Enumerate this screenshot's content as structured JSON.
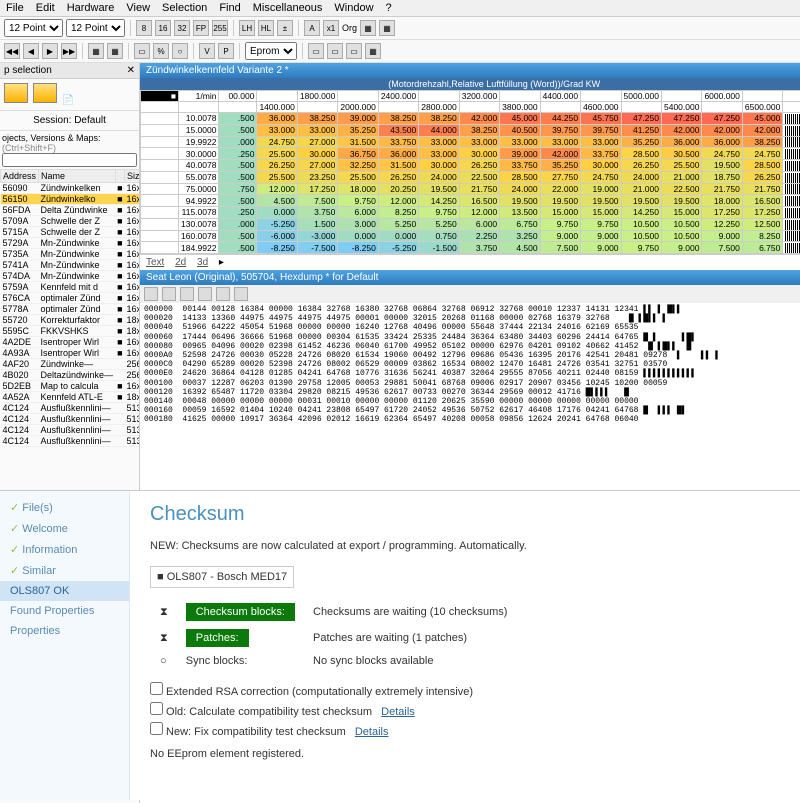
{
  "menu": [
    "File",
    "Edit",
    "Hardware",
    "View",
    "Selection",
    "Find",
    "Miscellaneous",
    "Window",
    "?"
  ],
  "toolbar": {
    "font1": "12 Point",
    "font2": "12 Point",
    "eprom": "Eprom"
  },
  "left": {
    "title": "p selection",
    "session": "Session: Default",
    "filter_label": "ojects, Versions & Maps:",
    "filter_hint": "(Ctrl+Shift+F)",
    "cols": [
      "Address",
      "Name",
      "",
      "Size"
    ],
    "rows": [
      [
        "56090",
        "Zündwinkelken",
        "■",
        "16x12"
      ],
      [
        "56150",
        "Zündwinkelko",
        "■",
        "16x12"
      ],
      [
        "56FDA",
        "Delta Zündwinke",
        "■",
        "16x12"
      ],
      [
        "5709A",
        "Schwelle der Z",
        "■",
        "16x12"
      ],
      [
        "5715A",
        "Schwelle der Z",
        "■",
        "16x12"
      ],
      [
        "5729A",
        "Mn-Zündwinke",
        "■",
        "16x12"
      ],
      [
        "5735A",
        "Mn-Zündwinke",
        "■",
        "16x12"
      ],
      [
        "5741A",
        "Mn-Zündwinke",
        "■",
        "16x12"
      ],
      [
        "574DA",
        "Mn-Zündwinke",
        "■",
        "16x12"
      ],
      [
        "5759A",
        "Kennfeld mit d",
        "■",
        "16x12"
      ],
      [
        "576CA",
        "optimaler Zünd",
        "■",
        "16x12"
      ],
      [
        "5778A",
        "optimaler Zünd",
        "■",
        "16x12"
      ],
      [
        "55720",
        "Korrekturfaktor",
        "■",
        "18x14"
      ],
      [
        "5595C",
        "FKKVSHKS",
        "■",
        "18x14"
      ],
      [
        "4A2DE",
        "Isentroper Wirl",
        "■",
        "16x16"
      ],
      [
        "4A93A",
        "Isentroper Wirl",
        "■",
        "16x16"
      ],
      [
        "4AF20",
        "Zündwinke—",
        "",
        "256x1"
      ],
      [
        "4B020",
        "Deltazündwinke—",
        "",
        "256x1"
      ],
      [
        "5D2EB",
        "Map to calcula",
        "■",
        "16x16"
      ],
      [
        "4A52A",
        "Kennfeld ATL-E",
        "■",
        "18x16"
      ],
      [
        "4C124",
        "Ausflußkennlini—",
        "",
        "513x1"
      ],
      [
        "4C124",
        "Ausflußkennlini—",
        "",
        "513x1"
      ],
      [
        "4C124",
        "Ausflußkennlini—",
        "",
        "513x1"
      ],
      [
        "4C124",
        "Ausflußkennlini—",
        "",
        "513x1"
      ]
    ]
  },
  "map": {
    "title": "Zündwinkelkennfeld Variante 2 *",
    "axis_label": "(Motordrehzahl,Relative Luftfüllung (Word))/Grad KW",
    "unit": "1/min",
    "cols_top": [
      "00.000",
      "",
      "1800.000",
      "",
      "2400.000",
      "",
      "3200.000",
      "",
      "4400.000",
      "",
      "5000.000",
      "",
      "6000.000",
      ""
    ],
    "cols_bot": [
      "",
      "1400.000",
      "",
      "2000.000",
      "",
      "2800.000",
      "",
      "3800.000",
      "",
      "4600.000",
      "",
      "5400.000",
      "",
      "6500.000"
    ],
    "rows": [
      {
        "h": "10.0078",
        "v": [
          ".500",
          "36.000",
          "38.250",
          "39.000",
          "38.250",
          "38.250",
          "42.000",
          "45.000",
          "44.250",
          "45.750",
          "47.250",
          "47.250",
          "47.250",
          "45.000"
        ]
      },
      {
        "h": "15.0000",
        "v": [
          ".500",
          "33.000",
          "33.000",
          "35.250",
          "43.500",
          "44.000",
          "38.250",
          "40.500",
          "39.750",
          "39.750",
          "41.250",
          "42.000",
          "42.000",
          "42.000"
        ]
      },
      {
        "h": "19.9922",
        "v": [
          ".000",
          "24.750",
          "27.000",
          "31.500",
          "33.750",
          "33.000",
          "33.000",
          "33.000",
          "33.000",
          "33.000",
          "35.250",
          "36.000",
          "36.000",
          "38.250"
        ]
      },
      {
        "h": "30.0000",
        "v": [
          ".250",
          "25.500",
          "30.000",
          "36.750",
          "36.000",
          "33.000",
          "30.000",
          "39.000",
          "42.000",
          "33.750",
          "28.500",
          "30.500",
          "24.750",
          "24.750"
        ]
      },
      {
        "h": "40.0078",
        "v": [
          ".500",
          "26.250",
          "27.000",
          "32.250",
          "31.500",
          "30.000",
          "26.250",
          "33.750",
          "35.250",
          "30.000",
          "26.250",
          "25.500",
          "19.500",
          "28.500"
        ]
      },
      {
        "h": "55.0078",
        "v": [
          ".500",
          "25.500",
          "23.250",
          "25.500",
          "26.250",
          "24.000",
          "22.500",
          "28.500",
          "27.750",
          "24.750",
          "24.000",
          "21.000",
          "18.750",
          "26.250"
        ]
      },
      {
        "h": "75.0000",
        "v": [
          ".750",
          "12.000",
          "17.250",
          "18.000",
          "20.250",
          "19.500",
          "21.750",
          "24.000",
          "22.000",
          "19.000",
          "21.000",
          "22.500",
          "21.750",
          "21.750"
        ]
      },
      {
        "h": "94.9922",
        "v": [
          ".500",
          "4.500",
          "7.500",
          "9.750",
          "12.000",
          "14.250",
          "16.500",
          "19.500",
          "19.500",
          "19.500",
          "19.500",
          "19.500",
          "18.000",
          "16.500"
        ]
      },
      {
        "h": "115.0078",
        "v": [
          ".250",
          "0.000",
          "3.750",
          "6.000",
          "8.250",
          "9.750",
          "12.000",
          "13.500",
          "15.000",
          "15.000",
          "14.250",
          "15.000",
          "17.250",
          "17.250"
        ]
      },
      {
        "h": "130.0078",
        "v": [
          ".000",
          "-5.250",
          "1.500",
          "3.000",
          "5.250",
          "5.250",
          "6.000",
          "6.750",
          "9.750",
          "9.750",
          "10.500",
          "10.500",
          "12.250",
          "12.500"
        ]
      },
      {
        "h": "160.0078",
        "v": [
          ".500",
          "-6.000",
          "-3.000",
          "0.000",
          "0.000",
          "0.750",
          "2.250",
          "3.250",
          "9.000",
          "9.000",
          "10.500",
          "10.500",
          "9.000",
          "8.250"
        ]
      },
      {
        "h": "184.9922",
        "v": [
          ".500",
          "-8.250",
          "-7.500",
          "-8.250",
          "-5.250",
          "-1.500",
          "3.750",
          "4.500",
          "7.500",
          "9.000",
          "9.750",
          "9.000",
          "7.500",
          "6.750"
        ]
      }
    ],
    "tabs": [
      "Text",
      "2d",
      "3d"
    ]
  },
  "hex": {
    "title": "Seat Leon (Original), 505704, Hexdump * for Default",
    "lines": [
      "000000  00144 00128 16384 00000 16384 32768 16380 32768 06864 32768 06912 32768 00010 12337 14131 12341 ▌▌ ▌ █▌▌",
      "000020  14133 13360 44975 44975 44975 44975 00001 00000 32015 20268 01168 00000 02768 16379 32768    █ ▌█▌▌ ▌",
      "000040  51966 64222 45054 51968 00000 00000 16240 12768 40496 00000 55648 37444 22134 24016 62169 65535",
      "000060  17444 06496 36666 51968 00000 00304 61535 33424 25335 24484 36364 63480 34403 60296 24414 64765 █ ▌     ▌█▌",
      "000080  00965 04096 00020 02398 61452 46236 06040 61700 49952 05102 00000 62976 04201 09102 40662 41452  █ ▌█▌▌  █",
      "0000A0  52598 24726 00030 05228 24726 08020 61534 19060 00492 12796 09686 05436 16395 20176 42541 20481 09278  ▌    ▌▌ ▌",
      "0000C0  04290 65289 00020 52398 24726 08002 06529 00009 03862 16534 08002 12470 16481 24726 03541 32751 03570",
      "0000E0  24620 36864 04128 01285 04241 64768 10776 31636 56241 40387 32064 29555 87056 40211 02440 08159 ▌▌▌▌▌▌▌▌▌▌▌",
      "000100  00037 12287 06203 01390 29758 12005 00053 29881 50041 68768 09006 02917 20907 03456 10245 10200 00059",
      "000120  16392 65487 11720 03304 29820 08215 49536 62617 00733 00270 36344 29569 00012 41716 █▌▌▌▌   █",
      "000140  00048 00000 00000 00000 00031 00010 00000 00000 01120 20625 35590 00000 00000 00000 00000 00000",
      "000160  00059 16592 01404 10240 04241 23808 65497 61720 24052 49536 50752 62617 46408 17176 04241 64768 █  ▌▌▌ █▌",
      "000180  41625 00000 10917 36364 42096 02012 16619 62364 65497 40208 00058 09856 12624 20241 64768 06040"
    ]
  },
  "checksum": {
    "heading": "Checksum",
    "note": "NEW: Checksums are now calculated at export / programming. Automatically.",
    "box": "OLS807 - Bosch MED17",
    "rows": [
      {
        "btn": "Checksum blocks:",
        "txt": "Checksums are waiting (10 checksums)"
      },
      {
        "btn": "Patches:",
        "txt": "Patches are waiting (1 patches)"
      },
      {
        "lbl": "Sync blocks:",
        "txt": "No sync blocks available"
      }
    ],
    "checks": [
      "Extended RSA correction (computationally extremely intensive)",
      "Old: Calculate compatibility test checksum",
      "New: Fix compatibility test checksum"
    ],
    "details": "Details",
    "footer": "No EEprom element registered.",
    "side": [
      "File(s)",
      "Welcome",
      "Information",
      "Similar",
      "OLS807 OK",
      "Found Properties",
      "Properties"
    ]
  }
}
